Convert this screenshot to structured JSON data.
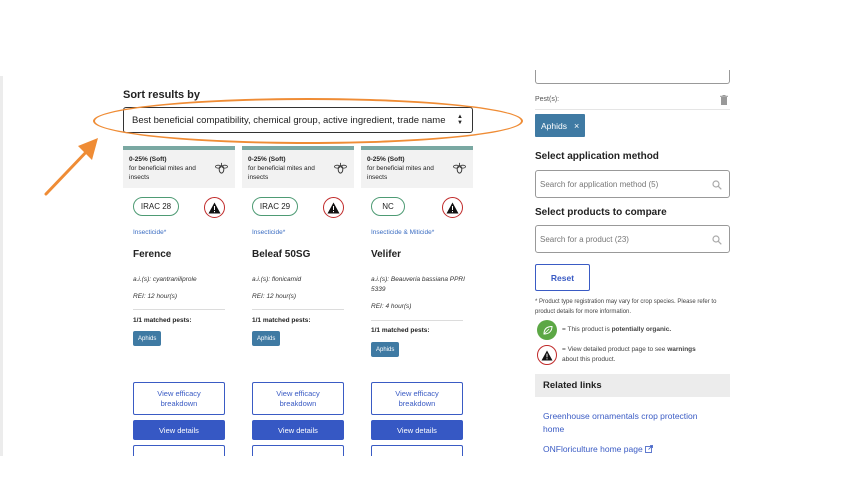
{
  "sort": {
    "label": "Sort results by",
    "selected": "Best beneficial compatibility, chemical group, active ingredient, trade name"
  },
  "cards": [
    {
      "tox_title": "0-25% (Soft)",
      "tox_desc": "for beneficial mites and insects",
      "group": "IRAC 28",
      "type": "Insecticide*",
      "name": "Ference",
      "ai": "a.i.(s): cyantraniliprole",
      "rei": "REI: 12 hour(s)",
      "matched": "1/1 matched pests:",
      "pest": "Aphids",
      "efficacy_label": "View efficacy breakdown",
      "details_label": "View details"
    },
    {
      "tox_title": "0-25% (Soft)",
      "tox_desc": "for beneficial mites and insects",
      "group": "IRAC 29",
      "type": "Insecticide*",
      "name": "Beleaf 50SG",
      "ai": "a.i.(s): flonicamid",
      "rei": "REI: 12 hour(s)",
      "matched": "1/1 matched pests:",
      "pest": "Aphids",
      "efficacy_label": "View efficacy breakdown",
      "details_label": "View details"
    },
    {
      "tox_title": "0-25% (Soft)",
      "tox_desc": "for beneficial mites and insects",
      "group": "NC",
      "type": "Insecticide & Miticide*",
      "name": "Velifer",
      "ai": "a.i.(s): Beauveria bassiana PPRI 5339",
      "rei": "REI: 4 hour(s)",
      "matched": "1/1 matched pests:",
      "pest": "Aphids",
      "efficacy_label": "View efficacy breakdown",
      "details_label": "View details"
    }
  ],
  "filters": {
    "pest_label": "Pest(s):",
    "pest_chip": "Aphids",
    "chip_remove": "×",
    "application_title": "Select application method",
    "application_placeholder": "Search for application method (5)",
    "compare_title": "Select products to compare",
    "compare_placeholder": "Search for a product (23)",
    "reset_label": "Reset",
    "note": "* Product type registration may vary for crop species. Please refer to product details for more information.",
    "legend_organic_pre": "= This product is ",
    "legend_organic_bold": "potentially organic.",
    "legend_warn_pre": "= View detailed product page to see ",
    "legend_warn_bold": "warnings",
    "legend_warn_post": " about this product."
  },
  "related": {
    "title": "Related links",
    "link1": "Greenhouse ornamentals crop protection home",
    "link2": "ONFloriculture home page"
  },
  "colors": {
    "accent_blue": "#3658c4",
    "chip_blue": "#3f7aa3",
    "highlight_orange": "#ef8c35",
    "warning_red": "#c02a2a",
    "organic_green": "#5ca745"
  }
}
